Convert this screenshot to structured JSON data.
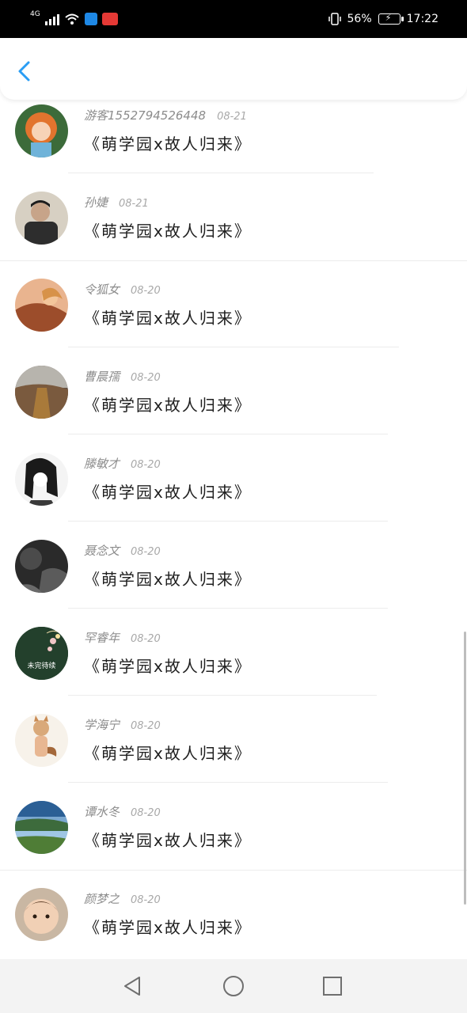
{
  "status_bar": {
    "network": "4G",
    "badge_icons": [
      "shield-badge-icon",
      "app-badge-icon"
    ],
    "signal": "56%",
    "time": "17:22"
  },
  "header": {
    "back_icon": "chevron-left-icon"
  },
  "list": {
    "items": [
      {
        "username": "游客15527945264​48",
        "date": "08-21",
        "message": "《萌学园x故人归来》"
      },
      {
        "username": "孙婕",
        "date": "08-21",
        "message": "《萌学园x故人归来》"
      },
      {
        "username": "令狐女",
        "date": "08-20",
        "message": "《萌学园x故人归来》"
      },
      {
        "username": "曹晨孺",
        "date": "08-20",
        "message": "《萌学园x故人归来》"
      },
      {
        "username": "滕敏才",
        "date": "08-20",
        "message": "《萌学园x故人归来》"
      },
      {
        "username": "聂念文",
        "date": "08-20",
        "message": "《萌学园x故人归来》"
      },
      {
        "username": "罕睿年",
        "date": "08-20",
        "message": "《萌学园x故人归来》"
      },
      {
        "username": "学海宁",
        "date": "08-20",
        "message": "《萌学园x故人归来》"
      },
      {
        "username": "谭水冬",
        "date": "08-20",
        "message": "《萌学园x故人归来》"
      },
      {
        "username": "颜梦之",
        "date": "08-20",
        "message": "《萌学园x故人归来》"
      }
    ],
    "avatar_overlay_text": "未完待续"
  },
  "nav_bar": {
    "icons": [
      "back-triangle-icon",
      "home-circle-icon",
      "recents-square-icon"
    ]
  },
  "colors": {
    "accent": "#2a9df4",
    "status_bar_bg": "#000000",
    "nav_bar_bg": "#f3f3f3"
  }
}
